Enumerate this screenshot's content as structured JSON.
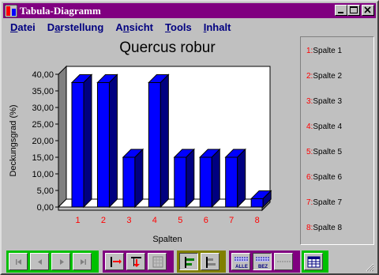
{
  "window": {
    "title": "Tabula-Diagramm"
  },
  "menu": [
    {
      "label": "Datei",
      "accel": "D"
    },
    {
      "label": "Darstellung",
      "accel": "a"
    },
    {
      "label": "Ansicht",
      "accel": "n"
    },
    {
      "label": "Tools",
      "accel": "T"
    },
    {
      "label": "Inhalt",
      "accel": "I"
    }
  ],
  "chart_data": {
    "type": "bar",
    "title": "Quercus robur",
    "xlabel": "Spalten",
    "ylabel": "Deckungsgrad (%)",
    "categories": [
      "1",
      "2",
      "3",
      "4",
      "5",
      "6",
      "7",
      "8"
    ],
    "values": [
      37.5,
      37.5,
      15,
      37.5,
      15,
      15,
      15,
      2.5
    ],
    "ylim": [
      0,
      40
    ],
    "yticks": [
      "0,00",
      "5,00",
      "10,00",
      "15,00",
      "20,00",
      "25,00",
      "30,00",
      "35,00",
      "40,00"
    ],
    "bar_color": "#0000ff",
    "category_label_color": "#ff0000",
    "grid": false,
    "legend_position": "right"
  },
  "legend": [
    {
      "num": "1:",
      "label": "Spalte 1"
    },
    {
      "num": "2:",
      "label": "Spalte 2"
    },
    {
      "num": "3:",
      "label": "Spalte 3"
    },
    {
      "num": "4:",
      "label": "Spalte 4"
    },
    {
      "num": "5:",
      "label": "Spalte 5"
    },
    {
      "num": "6:",
      "label": "Spalte 6"
    },
    {
      "num": "7:",
      "label": "Spalte 7"
    },
    {
      "num": "8:",
      "label": "Spalte 8"
    }
  ],
  "toolbar": {
    "group_colors": [
      "#00c000",
      "#800080",
      "#808000",
      "#800080",
      "#00c000"
    ],
    "buttons": [
      {
        "name": "first-record-icon"
      },
      {
        "name": "previous-record-icon"
      },
      {
        "name": "next-record-icon"
      },
      {
        "name": "last-record-icon"
      },
      {
        "name": "insert-column-icon"
      },
      {
        "name": "insert-row-icon"
      },
      {
        "name": "grid-icon"
      },
      {
        "name": "align-left-icon"
      },
      {
        "name": "align-left-alt-icon"
      },
      {
        "name": "alle-icon",
        "text": "ALLE"
      },
      {
        "name": "bez-icon",
        "text": "BEZ"
      },
      {
        "name": "dashed-line-icon"
      },
      {
        "name": "table-view-icon"
      }
    ]
  }
}
